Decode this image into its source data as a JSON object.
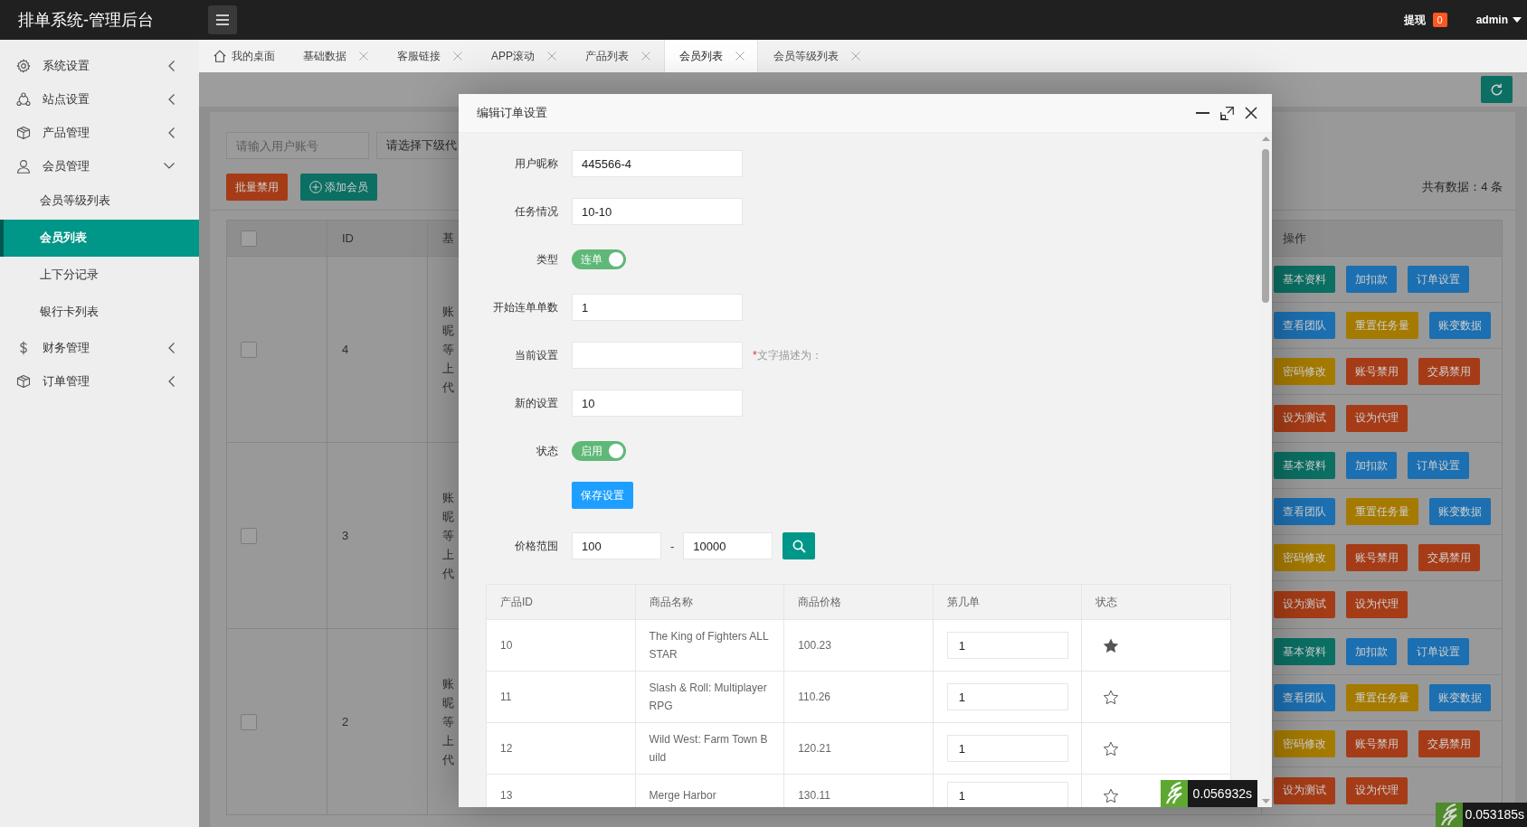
{
  "header": {
    "title": "排单系统-管理后台",
    "withdraw": {
      "label": "提现",
      "badge": "0"
    },
    "user": "admin"
  },
  "sidebar": {
    "items": [
      {
        "label": "系统设置",
        "expanded": false,
        "selected": false
      },
      {
        "label": "站点设置",
        "expanded": false,
        "selected": false
      },
      {
        "label": "产品管理",
        "expanded": false,
        "selected": false
      },
      {
        "label": "会员管理",
        "expanded": true,
        "selected": false,
        "children": [
          {
            "label": "会员等级列表",
            "selected": false
          },
          {
            "label": "会员列表",
            "selected": true
          },
          {
            "label": "上下分记录",
            "selected": false
          },
          {
            "label": "银行卡列表",
            "selected": false
          }
        ]
      },
      {
        "label": "财务管理",
        "expanded": false,
        "selected": false
      },
      {
        "label": "订单管理",
        "expanded": false,
        "selected": false
      }
    ]
  },
  "tabs": [
    {
      "label": "我的桌面",
      "kind": "home",
      "selected": false
    },
    {
      "label": "基础数据",
      "kind": "page",
      "selected": false
    },
    {
      "label": "客服链接",
      "kind": "page",
      "selected": false
    },
    {
      "label": "APP滚动",
      "kind": "page",
      "selected": false
    },
    {
      "label": "产品列表",
      "kind": "page",
      "selected": false
    },
    {
      "label": "会员列表",
      "kind": "page",
      "selected": true
    },
    {
      "label": "会员等级列表",
      "kind": "page",
      "selected": false
    }
  ],
  "filters": {
    "account": {
      "placeholder": "请输入用户账号"
    },
    "agent": {
      "value": "请选择下级代"
    }
  },
  "actions": [
    {
      "label": "批量禁用",
      "kind": "plain",
      "color": "#a53c17"
    },
    {
      "label": "添加会员",
      "kind": "add",
      "color": "#0b6f63"
    }
  ],
  "total": "共有数据：4 条",
  "member_table": {
    "select_all": {
      "checked": false
    },
    "columns": [
      "ID",
      "基",
      "操作"
    ],
    "rows": [
      {
        "checked": false,
        "id": "4",
        "info": [
          "账",
          "昵",
          "等",
          "上",
          "代"
        ],
        "action_lines": [
          [
            {
              "label": "基本资料",
              "color": "#0b6f63"
            },
            {
              "label": "加扣款",
              "color": "#1c6fb0"
            },
            {
              "label": "订单设置",
              "color": "#1c6fb0"
            }
          ],
          [
            {
              "label": "查看团队",
              "color": "#1c6fb0"
            },
            {
              "label": "重置任务量",
              "color": "#a57a00"
            },
            {
              "label": "账变数据",
              "color": "#1c6fb0"
            }
          ],
          [
            {
              "label": "密码修改",
              "color": "#a57a00"
            },
            {
              "label": "账号禁用",
              "color": "#a53c17"
            },
            {
              "label": "交易禁用",
              "color": "#a53c17"
            }
          ],
          [
            {
              "label": "设为测试",
              "color": "#a53c17"
            },
            {
              "label": "设为代理",
              "color": "#a53c17"
            }
          ]
        ]
      },
      {
        "checked": false,
        "id": "3",
        "info": [
          "账",
          "昵",
          "等",
          "上",
          "代"
        ],
        "action_lines": [
          [
            {
              "label": "基本资料",
              "color": "#0b6f63"
            },
            {
              "label": "加扣款",
              "color": "#1c6fb0"
            },
            {
              "label": "订单设置",
              "color": "#1c6fb0"
            }
          ],
          [
            {
              "label": "查看团队",
              "color": "#1c6fb0"
            },
            {
              "label": "重置任务量",
              "color": "#a57a00"
            },
            {
              "label": "账变数据",
              "color": "#1c6fb0"
            }
          ],
          [
            {
              "label": "密码修改",
              "color": "#a57a00"
            },
            {
              "label": "账号禁用",
              "color": "#a53c17"
            },
            {
              "label": "交易禁用",
              "color": "#a53c17"
            }
          ],
          [
            {
              "label": "设为测试",
              "color": "#a53c17"
            },
            {
              "label": "设为代理",
              "color": "#a53c17"
            }
          ]
        ]
      },
      {
        "checked": false,
        "id": "2",
        "info": [
          "账",
          "昵",
          "等",
          "上",
          "代"
        ],
        "action_lines": [
          [
            {
              "label": "基本资料",
              "color": "#0b6f63"
            },
            {
              "label": "加扣款",
              "color": "#1c6fb0"
            },
            {
              "label": "订单设置",
              "color": "#1c6fb0"
            }
          ],
          [
            {
              "label": "查看团队",
              "color": "#1c6fb0"
            },
            {
              "label": "重置任务量",
              "color": "#a57a00"
            },
            {
              "label": "账变数据",
              "color": "#1c6fb0"
            }
          ],
          [
            {
              "label": "密码修改",
              "color": "#a57a00"
            },
            {
              "label": "账号禁用",
              "color": "#a53c17"
            },
            {
              "label": "交易禁用",
              "color": "#a53c17"
            }
          ],
          [
            {
              "label": "设为测试",
              "color": "#a53c17"
            },
            {
              "label": "设为代理",
              "color": "#a53c17"
            }
          ]
        ]
      }
    ]
  },
  "page_timer": "0.053185s",
  "dialog": {
    "title": "编辑订单设置",
    "fields": [
      {
        "kind": "input",
        "label": "用户昵称",
        "value": "445566-4"
      },
      {
        "kind": "input",
        "label": "任务情况",
        "value": "10-10"
      },
      {
        "kind": "switch",
        "label": "类型",
        "text": "连单",
        "on": true
      },
      {
        "kind": "input",
        "label": "开始连单单数",
        "value": "1"
      },
      {
        "kind": "input",
        "label": "当前设置",
        "note_mark": "*",
        "note": "文字描述为："
      },
      {
        "kind": "input",
        "label": "新的设置",
        "value": "10"
      },
      {
        "kind": "switch",
        "label": "状态",
        "text": "启用",
        "on": true
      }
    ],
    "save_button": "保存设置",
    "price_range": {
      "label": "价格范围",
      "min": "100",
      "separator": "-",
      "max": "10000"
    },
    "products": {
      "columns": [
        "产品ID",
        "商品名称",
        "商品价格",
        "第几单",
        "状态"
      ],
      "rows": [
        {
          "id": "10",
          "name": "The King of Fighters ALL STAR",
          "price": "100.23",
          "order": "1",
          "starred": true
        },
        {
          "id": "11",
          "name": "Slash & Roll: Multiplayer RPG",
          "price": "110.26",
          "order": "1",
          "starred": false
        },
        {
          "id": "12",
          "name": "Wild West: Farm Town Build",
          "price": "120.21",
          "order": "1",
          "starred": false
        },
        {
          "id": "13",
          "name": "Merge Harbor",
          "price": "130.11",
          "order": "1",
          "starred": false
        }
      ]
    },
    "timer": "0.056932s"
  }
}
